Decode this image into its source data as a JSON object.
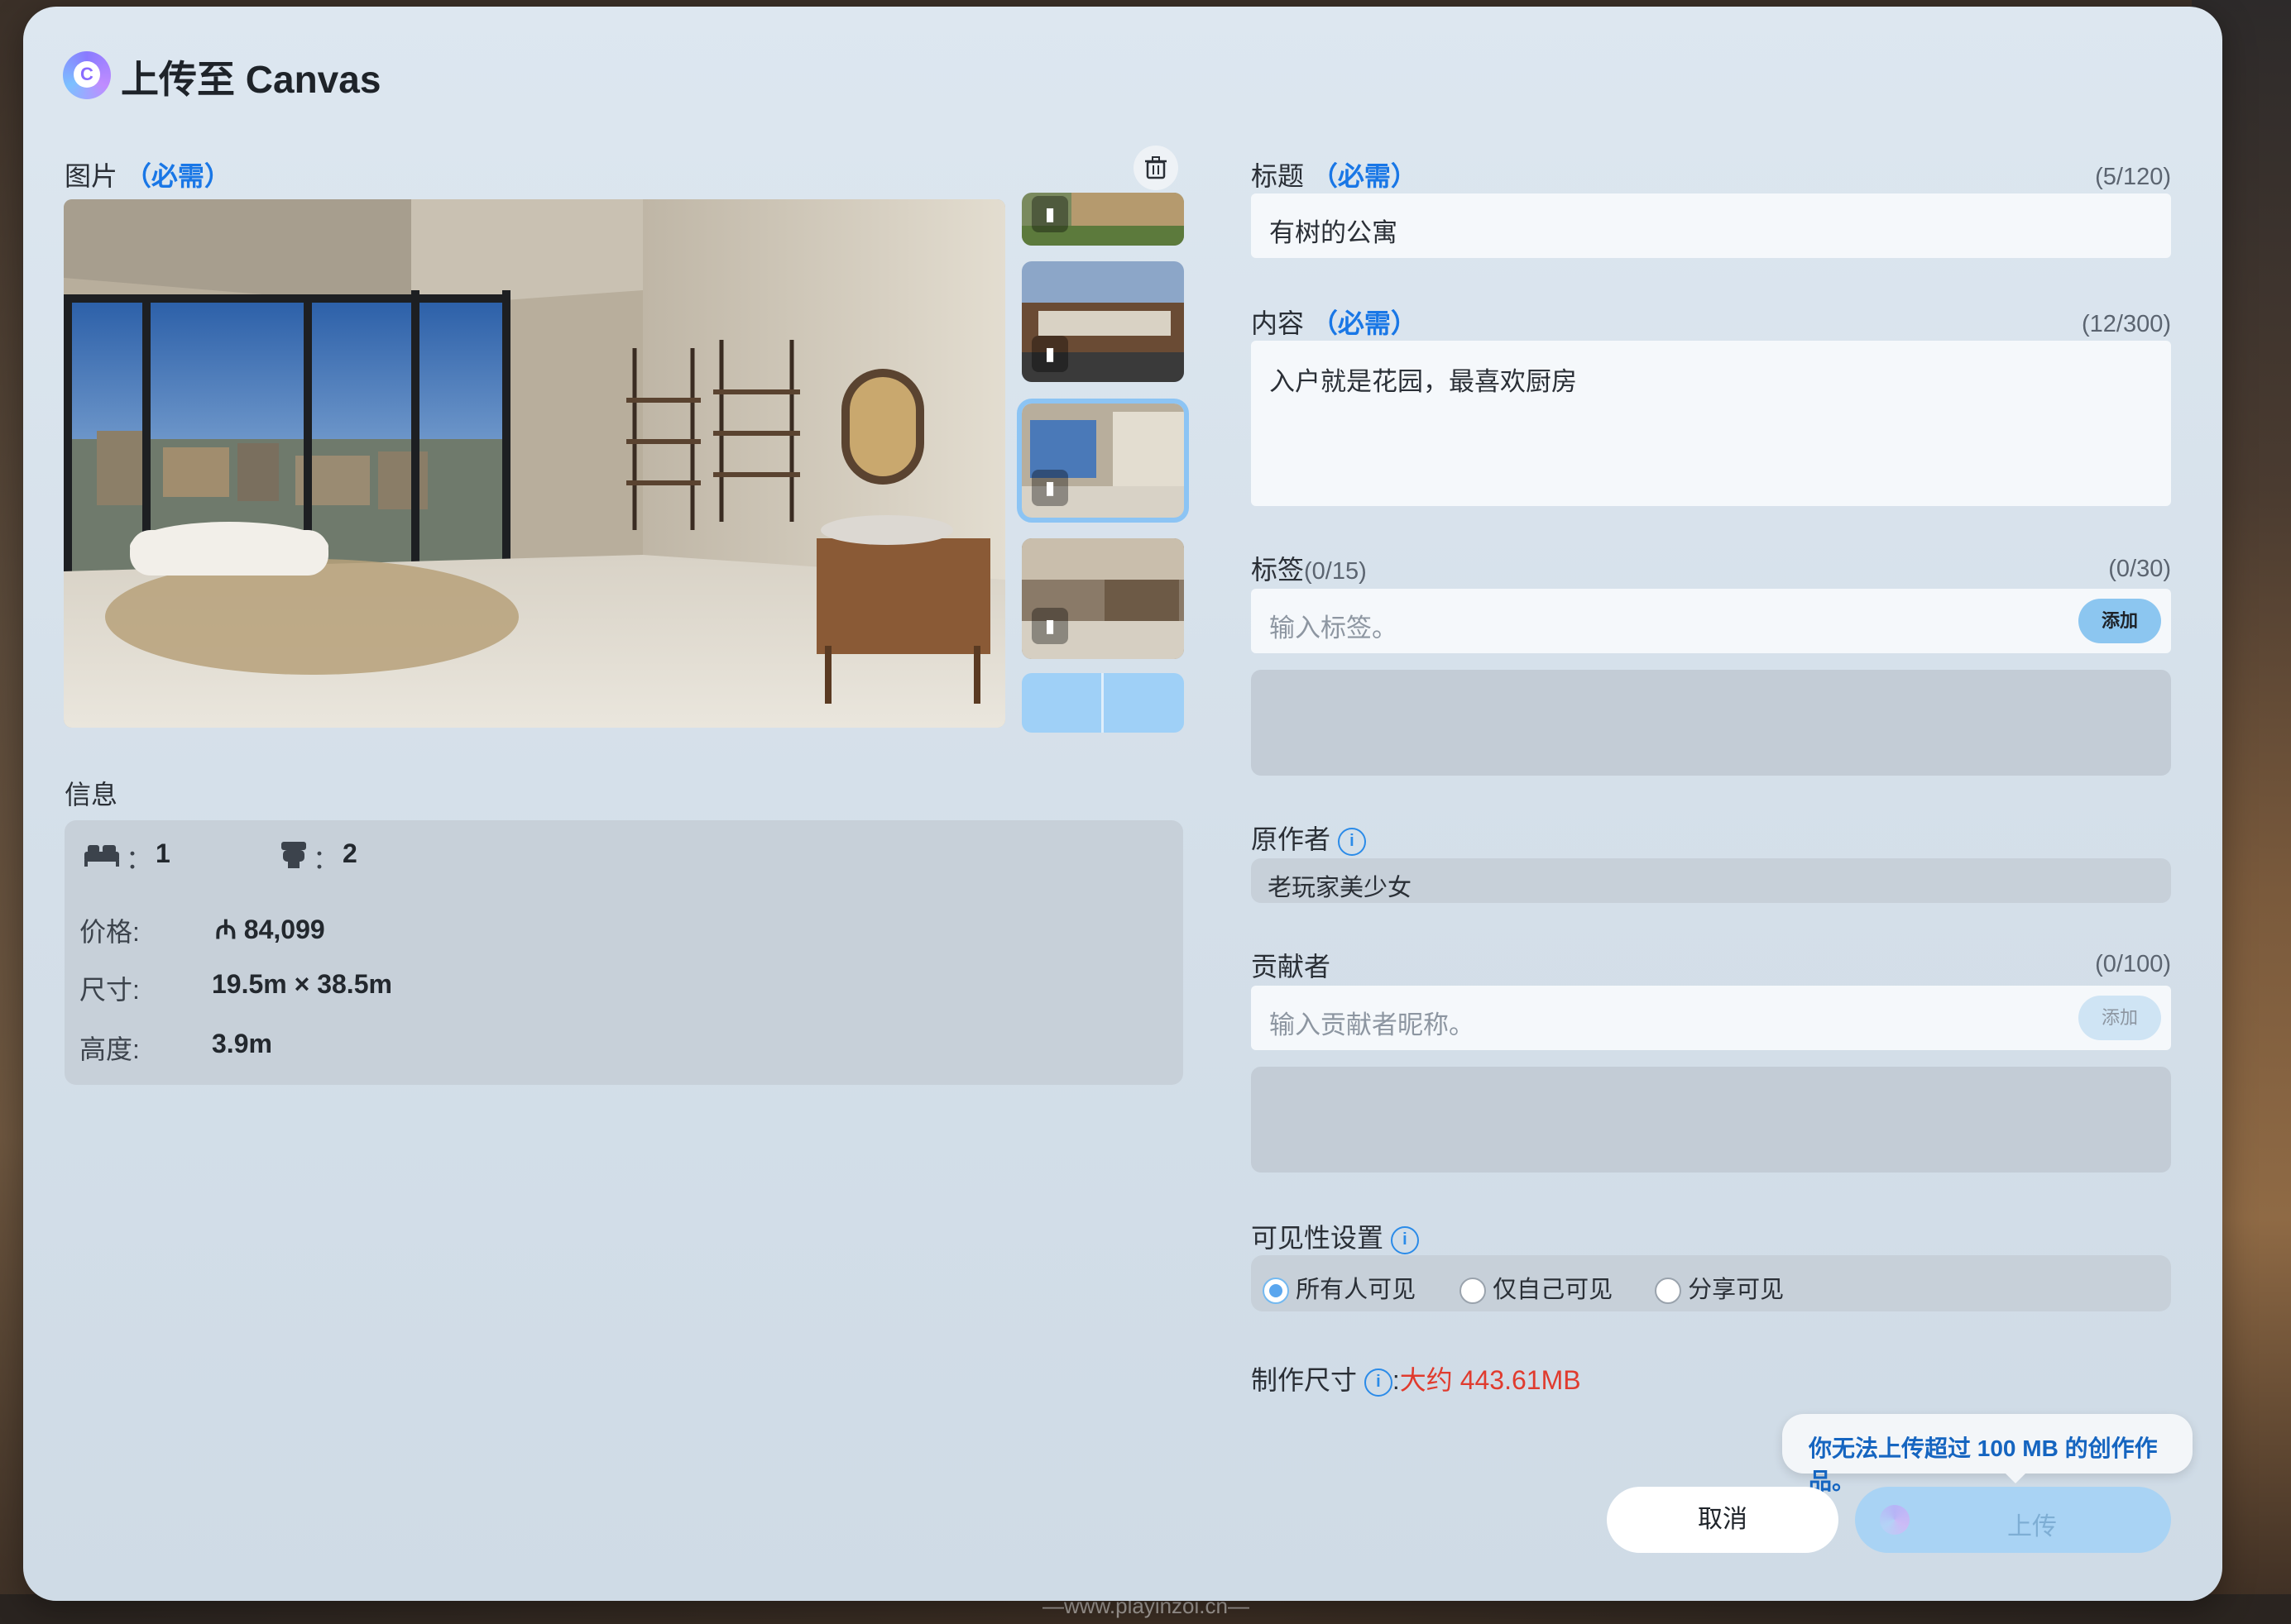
{
  "dialog": {
    "title": "上传至 Canvas",
    "logo_icon": "canvas-logo-icon"
  },
  "image_section": {
    "label": "图片",
    "required": "（必需）",
    "delete_icon": "trash-icon"
  },
  "info": {
    "label": "信息",
    "bedrooms_icon": "bed-icon",
    "bedrooms": "1",
    "bathrooms_icon": "toilet-icon",
    "bathrooms": "2",
    "price_label": "价格:",
    "price_value": "₼ 84,099",
    "size_label": "尺寸:",
    "size_value": "19.5m × 38.5m",
    "height_label": "高度:",
    "height_value": "3.9m",
    "colon": "："
  },
  "form": {
    "title_label": "标题",
    "title_required": "（必需）",
    "title_counter": "(5/120)",
    "title_value": "有树的公寓",
    "content_label": "内容",
    "content_required": "（必需）",
    "content_counter": "(12/300)",
    "content_value": "入户就是花园，最喜欢厨房",
    "tags_label": "标签",
    "tags_count": "(0/15)",
    "tags_counter": "(0/30)",
    "tags_placeholder": "输入标签。",
    "tags_add": "添加",
    "author_label": "原作者",
    "author_value": "老玩家美少女",
    "contrib_label": "贡献者",
    "contrib_counter": "(0/100)",
    "contrib_placeholder": "输入贡献者昵称。",
    "contrib_add": "添加",
    "visibility_label": "可见性设置",
    "visibility_options": [
      "所有人可见",
      "仅自己可见",
      "分享可见"
    ],
    "visibility_selected": "所有人可见",
    "size_label": "制作尺寸",
    "size_colon": ":",
    "size_value": "大约 443.61MB",
    "size_value_color": "#e03b2e"
  },
  "tooltip": {
    "text": "你无法上传超过 100 MB 的创作作品。"
  },
  "buttons": {
    "cancel": "取消",
    "upload": "上传"
  },
  "watermark": "—www.playinzoi.cn—",
  "colors": {
    "accent": "#1977e6",
    "selected_outline": "#8cc4f4",
    "warning": "#e03b2e"
  }
}
